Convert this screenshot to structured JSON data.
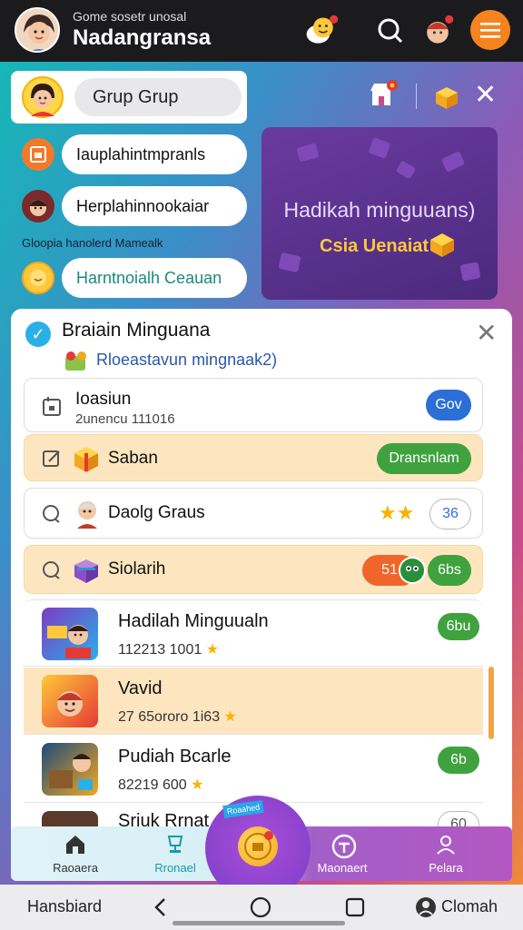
{
  "header": {
    "subtitle": "Gome sosetr unosal",
    "title": "Nadangransa",
    "icons": [
      "chat-bubble-icon",
      "search-icon",
      "notification-avatar-icon",
      "menu-icon"
    ],
    "accent": "#f5841f"
  },
  "group": {
    "label": "Grup Grup",
    "actions": [
      "store-icon",
      "gift-box-icon",
      "close-icon"
    ]
  },
  "side_items": [
    {
      "label": "Iauplahintmpranls",
      "icon": "calendar-icon"
    },
    {
      "label": "Herplahinnookaiar",
      "icon": "avatar"
    },
    {
      "label": "Harntnoialh Ceauan",
      "icon": "coin-icon"
    }
  ],
  "side_caption": "Gloopia hanolerd Mamealk",
  "promo": {
    "title": "Hadikah minguuans)",
    "subtitle": "Csia Uenaiat"
  },
  "panel": {
    "title": "Braiain Minguana",
    "subtitle": "Rloeastavun mingnaak2)",
    "rows": [
      {
        "label": "Ioasiun",
        "meta": "2unencu 111016",
        "button": "Gov",
        "button_color": "#2b6fd6"
      },
      {
        "label": "Saban",
        "button": "Dransnlam",
        "button_color": "#3fa23f"
      },
      {
        "label": "Daolg Graus",
        "stars": 2,
        "button": "36"
      },
      {
        "label": "Siolarih",
        "button_left": "51",
        "button": "6bs",
        "button_color": "#3fa23f"
      }
    ],
    "games": [
      {
        "name": "Hadilah Minguualn",
        "meta": "112213 1001",
        "button": "6bu"
      },
      {
        "name": "Vavid",
        "meta": "27 65ororo 1i63"
      },
      {
        "name": "Pudiah Bcarle",
        "meta": "82219 600",
        "button": "6b"
      },
      {
        "name": "Sriuk Rrnat",
        "button": "60"
      }
    ]
  },
  "nav": {
    "items": [
      {
        "label": "Raoaera",
        "icon": "home-icon"
      },
      {
        "label": "Rronael",
        "icon": "trophy-icon"
      },
      {
        "label": "Maonaert",
        "icon": "badge-icon"
      },
      {
        "label": "Pelara",
        "icon": "profile-icon"
      }
    ],
    "center_tag": "Roaahed"
  },
  "system": {
    "left": "Hansbiard",
    "right": "Clomah"
  }
}
